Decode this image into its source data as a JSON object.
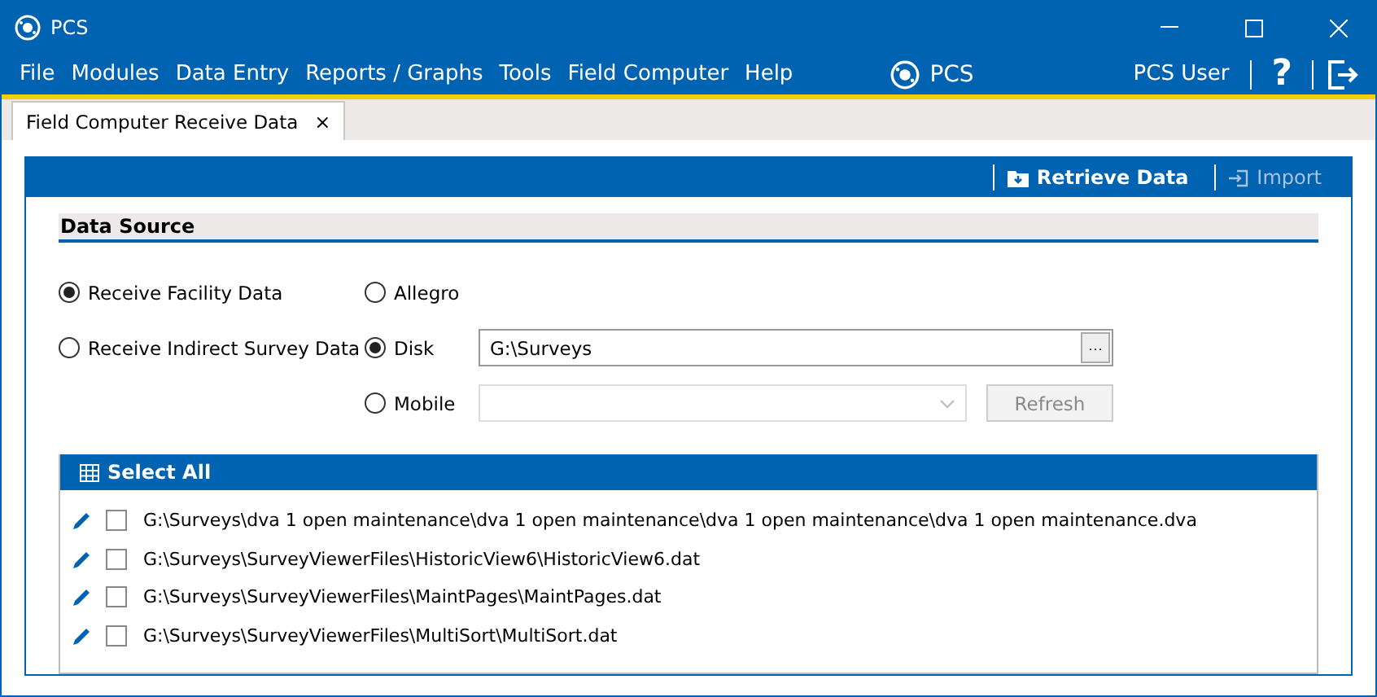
{
  "window": {
    "title": "PCS"
  },
  "menu": [
    "File",
    "Modules",
    "Data Entry",
    "Reports / Graphs",
    "Tools",
    "Field Computer",
    "Help"
  ],
  "brand": "PCS",
  "user": "PCS User",
  "help": "?",
  "tabs": [
    {
      "label": "Field Computer Receive Data",
      "selected": true,
      "close": "×"
    }
  ],
  "toolbar": [
    {
      "label": "Retrieve Data",
      "disabled": false,
      "kind": "retrieve"
    },
    {
      "label": "Import",
      "disabled": true,
      "kind": "import"
    }
  ],
  "section": "Data Source",
  "data_types": [
    {
      "label": "Receive Facility Data",
      "selected": true
    },
    {
      "label": "Receive Indirect Survey Data",
      "selected": false
    }
  ],
  "sources": [
    {
      "label": "Allegro",
      "selected": false,
      "kind": "plain"
    },
    {
      "label": "Disk",
      "selected": true,
      "kind": "path",
      "value": "G:\\Surveys",
      "browse": "···"
    },
    {
      "label": "Mobile",
      "selected": false,
      "kind": "device",
      "disabled": true,
      "button": "Refresh"
    }
  ],
  "files": {
    "header": "Select All",
    "rows": [
      {
        "path": "G:\\Surveys\\dva 1 open maintenance\\dva 1 open maintenance\\dva 1 open maintenance\\dva 1 open maintenance.dva",
        "checked": false
      },
      {
        "path": "G:\\Surveys\\SurveyViewerFiles\\HistoricView6\\HistoricView6.dat",
        "checked": false
      },
      {
        "path": "G:\\Surveys\\SurveyViewerFiles\\MaintPages\\MaintPages.dat",
        "checked": false
      },
      {
        "path": "G:\\Surveys\\SurveyViewerFiles\\MultiSort\\MultiSort.dat",
        "checked": false
      }
    ]
  }
}
